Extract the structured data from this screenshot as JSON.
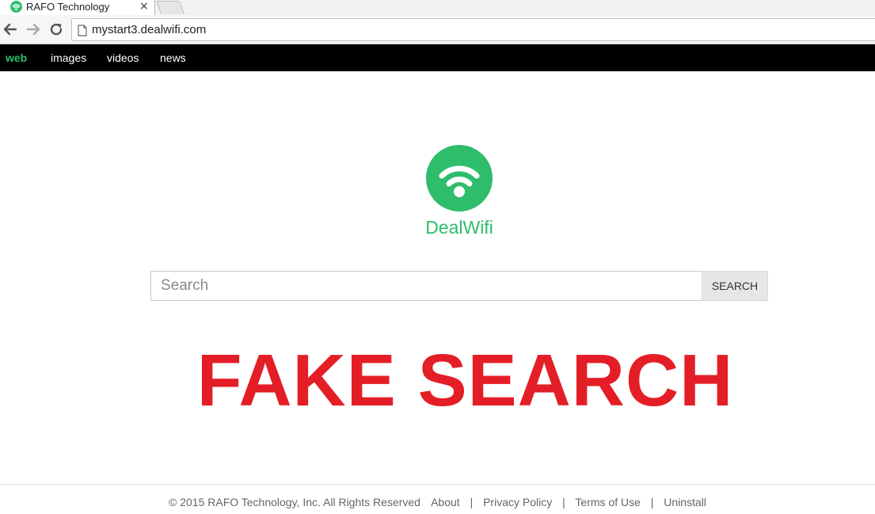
{
  "browser": {
    "tab_title": "RAFO Technology",
    "tab_close": "×",
    "url": "mystart3.dealwifi.com"
  },
  "nav": {
    "items": [
      {
        "label": "web",
        "active": true
      },
      {
        "label": "images",
        "active": false
      },
      {
        "label": "videos",
        "active": false
      },
      {
        "label": "news",
        "active": false
      }
    ]
  },
  "logo": {
    "brand": "DealWifi",
    "icon": "wifi-icon",
    "color": "#2ebd6b"
  },
  "search": {
    "placeholder": "Search",
    "button_label": "SEARCH"
  },
  "overlay": {
    "text": "FAKE SEARCH",
    "color": "#e41e26"
  },
  "footer": {
    "copyright": "© 2015 RAFO Technology, Inc. All Rights Reserved",
    "links": [
      "About",
      "Privacy Policy",
      "Terms of Use",
      "Uninstall"
    ],
    "separator": "|"
  }
}
